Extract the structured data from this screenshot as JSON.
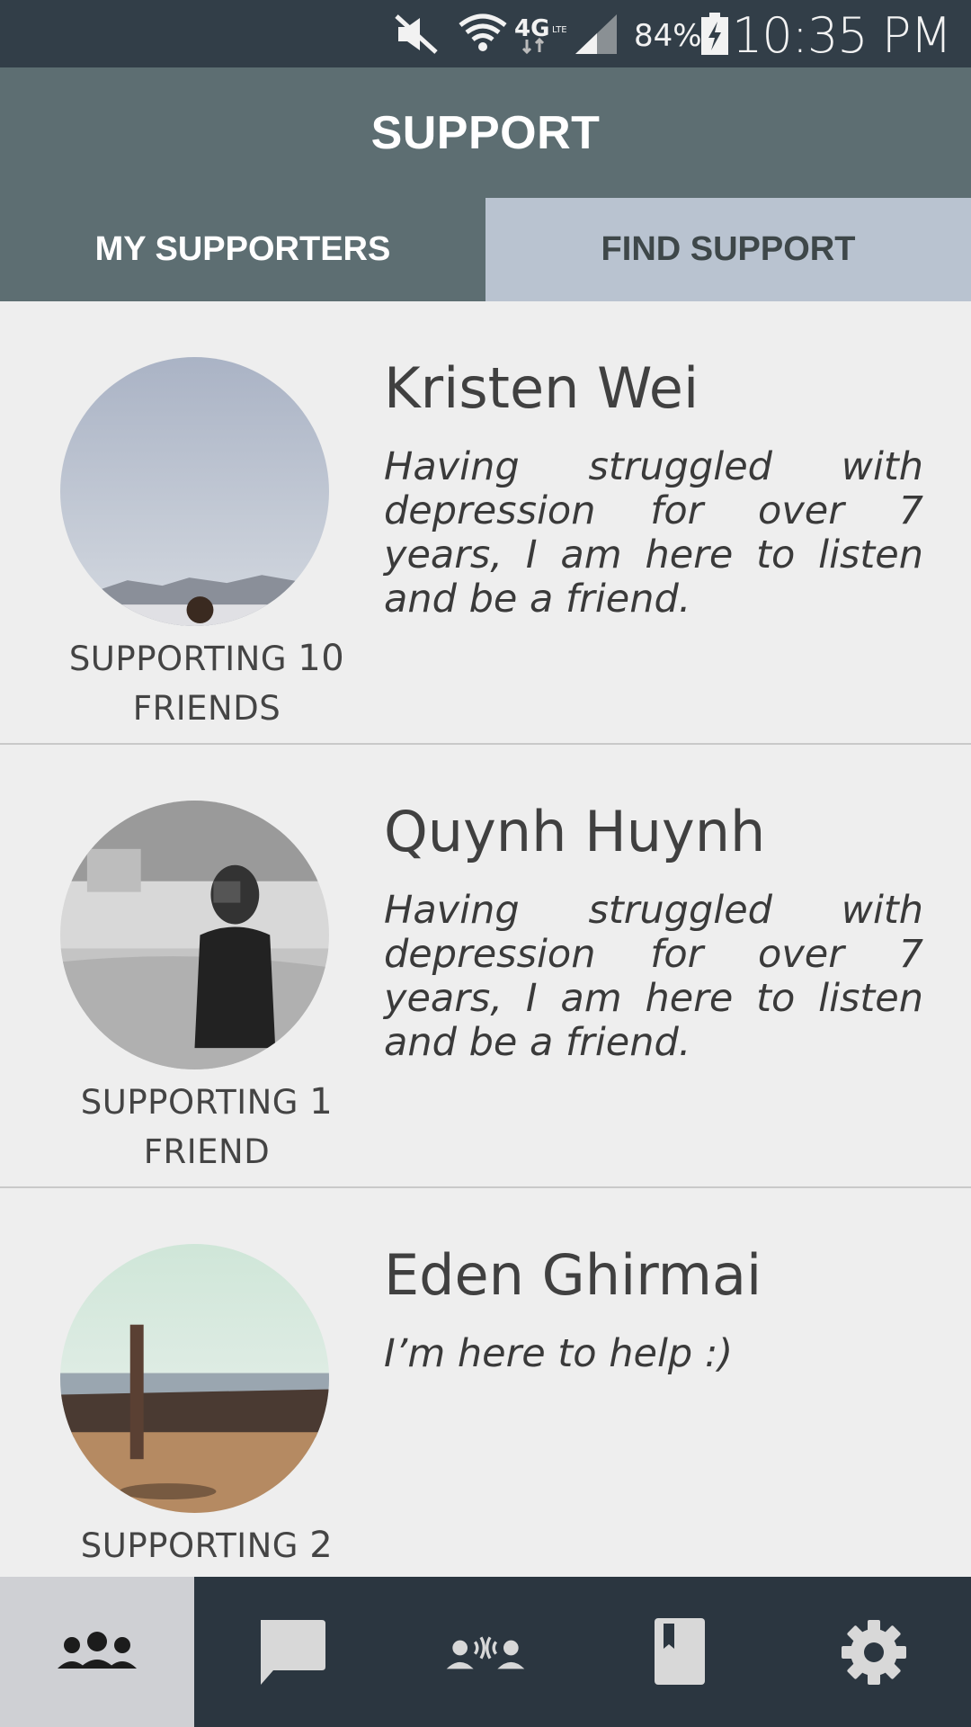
{
  "status_bar": {
    "battery_percent": "84%",
    "time": "10:35 PM",
    "icons": [
      "mute-icon",
      "wifi-icon",
      "4g-lte-icon",
      "signal-icon",
      "battery-charging-icon"
    ]
  },
  "header": {
    "title": "SUPPORT"
  },
  "tabs": [
    {
      "label": "MY SUPPORTERS",
      "active": true
    },
    {
      "label": "FIND SUPPORT",
      "active": false
    }
  ],
  "supporters": [
    {
      "name": "Kristen Wei",
      "bio": "Having struggled with depression for over 7 years, I am here to listen and be a friend.",
      "supporting_label": "SUPPORTING",
      "count": "10",
      "unit": "FRIENDS"
    },
    {
      "name": "Quynh Huynh",
      "bio": "Having struggled with depression for over 7 years, I am here to listen and be a friend.",
      "supporting_label": "SUPPORTING",
      "count": "1",
      "unit": "FRIEND"
    },
    {
      "name": "Eden Ghirmai",
      "bio": "I’m here to help :)",
      "supporting_label": "SUPPORTING",
      "count": "2",
      "unit": ""
    }
  ],
  "bottom_nav": [
    {
      "icon": "group-icon",
      "active": true
    },
    {
      "icon": "chat-icon",
      "active": false
    },
    {
      "icon": "talk-icon",
      "active": false
    },
    {
      "icon": "book-icon",
      "active": false
    },
    {
      "icon": "gear-icon",
      "active": false
    }
  ],
  "colors": {
    "status_bar": "#323e48",
    "header": "#5d6e72",
    "tab_inactive": "#b9c3d0",
    "background": "#eeeeee",
    "bottom_nav": "#2b3640",
    "bottom_nav_active": "#cfd0d4"
  }
}
